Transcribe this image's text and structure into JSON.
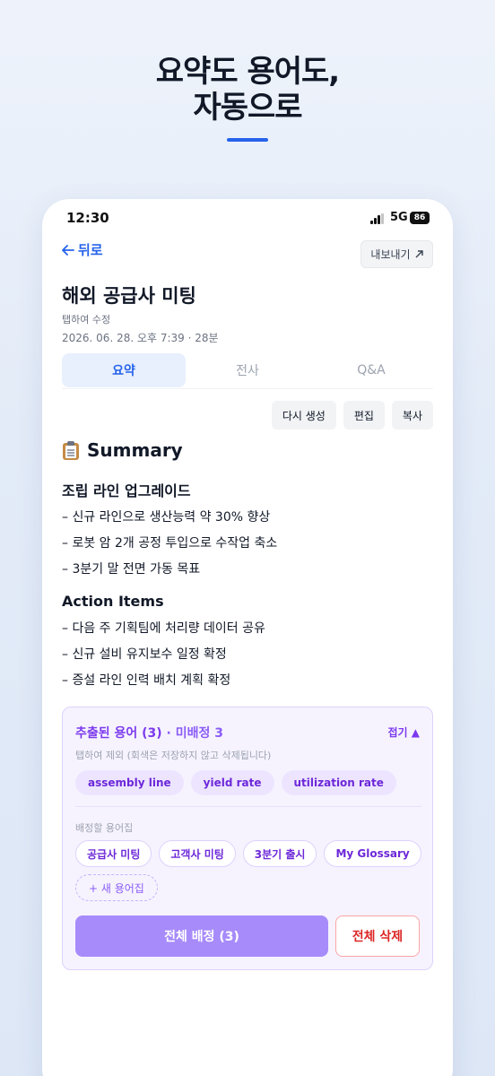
{
  "headline": {
    "line1": "요약도 용어도,",
    "line2": "자동으로"
  },
  "status_bar": {
    "time": "12:30",
    "network": "5G",
    "battery": "86"
  },
  "nav": {
    "back_label": "뒤로",
    "export_label": "내보내기"
  },
  "meeting": {
    "title": "해외 공급사 미팅",
    "edit_hint": "탭하여 수정",
    "datetime": "2026. 06. 28. 오후 7:39 · 28분"
  },
  "tabs": [
    {
      "label": "요약",
      "active": true
    },
    {
      "label": "전사",
      "active": false
    },
    {
      "label": "Q&A",
      "active": false
    }
  ],
  "actions": {
    "regenerate": "다시 생성",
    "edit": "편집",
    "copy": "복사"
  },
  "summary": {
    "heading": "Summary",
    "icon": "clipboard-icon",
    "sections": [
      {
        "title": "조립 라인 업그레이드",
        "bullets": [
          "– 신규 라인으로 생산능력 약 30% 향상",
          "– 로봇 암 2개 공정 투입으로 수작업 축소",
          "– 3분기 말 전면 가동 목표"
        ]
      },
      {
        "title": "Action Items",
        "bullets": [
          "– 다음 주 기획팀에 처리량 데이터 공유",
          "– 신규 설비 유지보수 일정 확정",
          "– 증설 라인 인력 배치 계획 확정"
        ]
      }
    ]
  },
  "terms": {
    "title_main": "추출된 용어 (3)",
    "title_sub": " · 미배정 3",
    "collapse_label": "접기 ▲",
    "hint": "탭하여 제외 (회색은 저장하지 않고 삭제됩니다)",
    "items": [
      "assembly line",
      "yield rate",
      "utilization rate"
    ],
    "glossary_label": "배정할 용어집",
    "glossaries": [
      "공급사 미팅",
      "고객사 미팅",
      "3분기 출시",
      "My Glossary"
    ],
    "new_glossary": "+ 새 용어집",
    "assign_all": "전체 배정 (3)",
    "delete_all": "전체 삭제"
  },
  "colors": {
    "accent": "#2563eb",
    "purple": "#7c3aed",
    "danger": "#dc2626"
  }
}
